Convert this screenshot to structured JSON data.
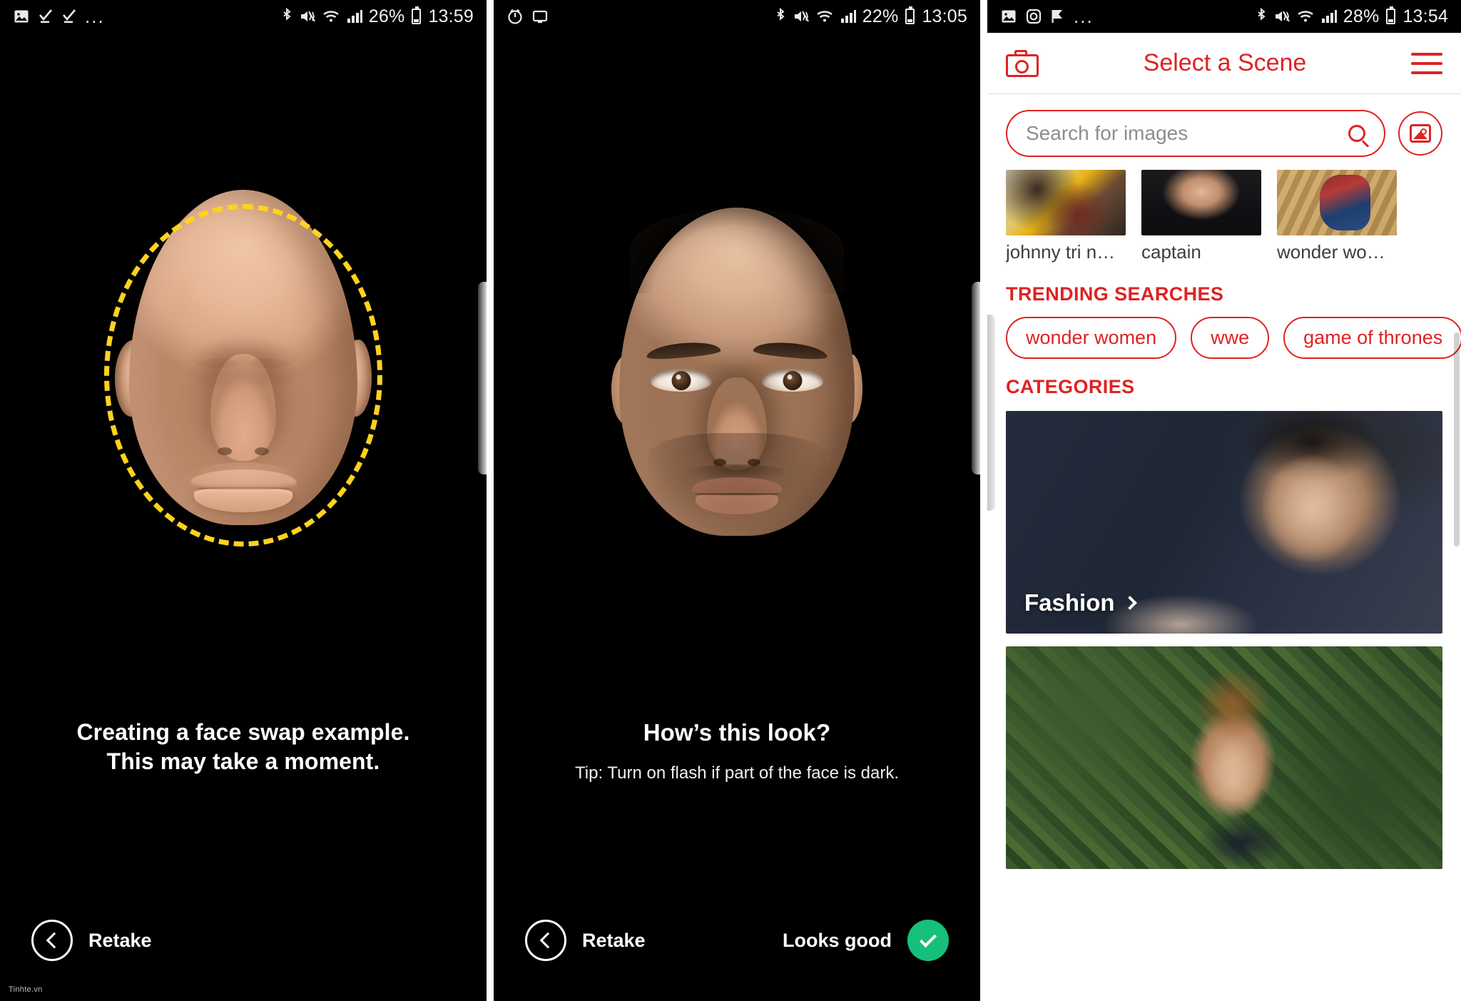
{
  "panel1": {
    "status": {
      "icons": [
        "image-icon",
        "task-done-icon",
        "task-done-icon",
        "more-icon"
      ],
      "more": "...",
      "bluetooth": "bluetooth-icon",
      "mute": "vibrate-mute-icon",
      "wifi": "wifi-icon",
      "signal": "signal-bars-icon",
      "battery_pct": "26%",
      "time": "13:59"
    },
    "heading_line1": "Creating a face swap example.",
    "heading_line2": "This may take a moment.",
    "retake_label": "Retake",
    "face_guide": "dashed-oval-face-guide",
    "guide_color": "#ffd21e"
  },
  "panel2": {
    "status": {
      "icons": [
        "alarm-icon",
        "screen-cast-icon"
      ],
      "bluetooth": "bluetooth-icon",
      "mute": "vibrate-mute-icon",
      "wifi": "wifi-icon",
      "signal": "signal-bars-icon",
      "battery_pct": "22%",
      "time": "13:05"
    },
    "heading": "How’s this look?",
    "tip": "Tip: Turn on flash if part of the face is dark.",
    "retake_label": "Retake",
    "confirm_label": "Looks good",
    "confirm_color": "#16c07a"
  },
  "panel3": {
    "status": {
      "icons": [
        "image-icon",
        "instagram-icon",
        "flag-icon",
        "more-icon"
      ],
      "more": "...",
      "bluetooth": "bluetooth-icon",
      "mute": "vibrate-mute-icon",
      "wifi": "wifi-icon",
      "signal": "signal-bars-icon",
      "battery_pct": "28%",
      "time": "13:54"
    },
    "header": {
      "camera_icon": "camera-icon",
      "title": "Select a Scene",
      "menu_icon": "hamburger-menu-icon"
    },
    "search": {
      "placeholder": "Search for images",
      "value": "",
      "search_icon": "search-icon",
      "gallery_icon": "gallery-picker-icon"
    },
    "recent": [
      {
        "label": "johnny tri n…",
        "thumb": "thumb-a"
      },
      {
        "label": "captain",
        "thumb": "thumb-b"
      },
      {
        "label": "wonder wo…",
        "thumb": "thumb-c"
      }
    ],
    "trending_title": "TRENDING SEARCHES",
    "trending": [
      "wonder women",
      "wwe",
      "game of thrones"
    ],
    "categories_title": "CATEGORIES",
    "categories": [
      {
        "label": "Fashion",
        "bg": "fashion-bg",
        "has_label": true
      },
      {
        "label": "",
        "bg": "nature-bg",
        "has_label": false
      }
    ],
    "accent_color": "#e02222"
  },
  "watermark": "Tinhte.vn"
}
